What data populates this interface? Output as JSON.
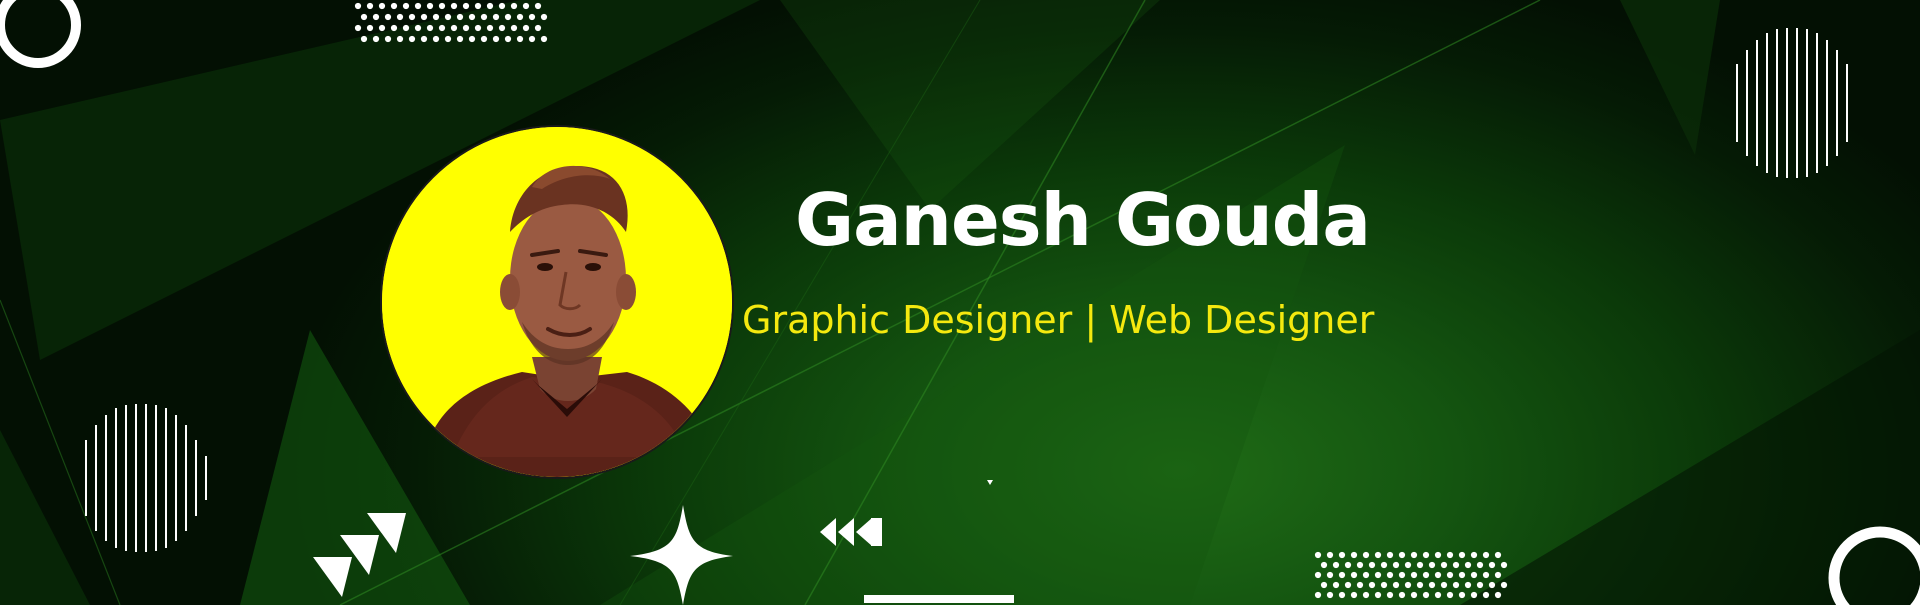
{
  "profile": {
    "name": "Ganesh Gouda",
    "role": "Graphic Designer | Web Designer",
    "avatar_alt": "Profile photo of Ganesh Gouda on yellow background"
  },
  "colors": {
    "background_dark": "#031003",
    "background_glow": "#1f6b16",
    "accent_yellow": "#f5e90f",
    "avatar_bg": "#ffff00",
    "text_white": "#ffffff",
    "shape_white": "#ffffff"
  },
  "decorations": [
    "ring-icon",
    "dot-grid",
    "striped-circle",
    "triangle-arrows-icon",
    "sparkle-star-icon",
    "rewind-arrows-icon",
    "underline-bar"
  ]
}
